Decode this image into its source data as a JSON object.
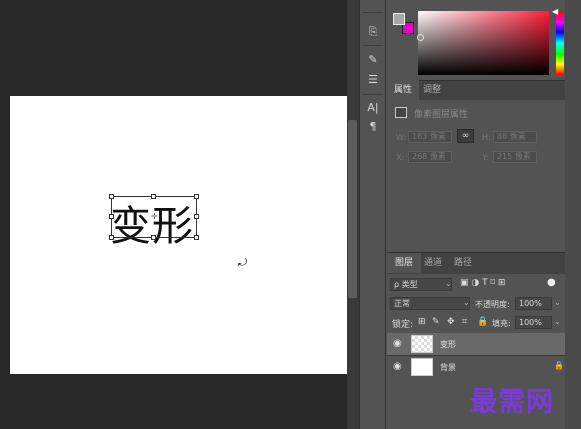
{
  "canvas": {
    "text": "变形"
  },
  "toolbar": {
    "char_label": "A|",
    "para_label": "¶"
  },
  "color": {
    "foreground": "#a8a8a8",
    "background": "#e600c8",
    "hue": "#ff1f3a"
  },
  "properties": {
    "tabs": [
      "属性",
      "调整"
    ],
    "title": "像素图层属性",
    "w_label": "W:",
    "w_value": "183 像素",
    "h_label": "H:",
    "h_value": "88 像素",
    "x_label": "X:",
    "x_value": "268 像素",
    "y_label": "Y:",
    "y_value": "215 像素",
    "link_icon": "link-icon"
  },
  "layers": {
    "tabs": [
      "图层",
      "通道",
      "路径"
    ],
    "filter_label": "ρ 类型",
    "filter_icons": "▣ ◑ T ⌑ ⊞",
    "blend_mode": "正常",
    "opacity_label": "不透明度:",
    "opacity_value": "100%",
    "lock_label": "锁定:",
    "fill_label": "填充:",
    "fill_value": "100%",
    "items": [
      {
        "name": "变形",
        "type": "text"
      },
      {
        "name": "背景",
        "type": "background"
      }
    ]
  },
  "watermark": "最需网"
}
